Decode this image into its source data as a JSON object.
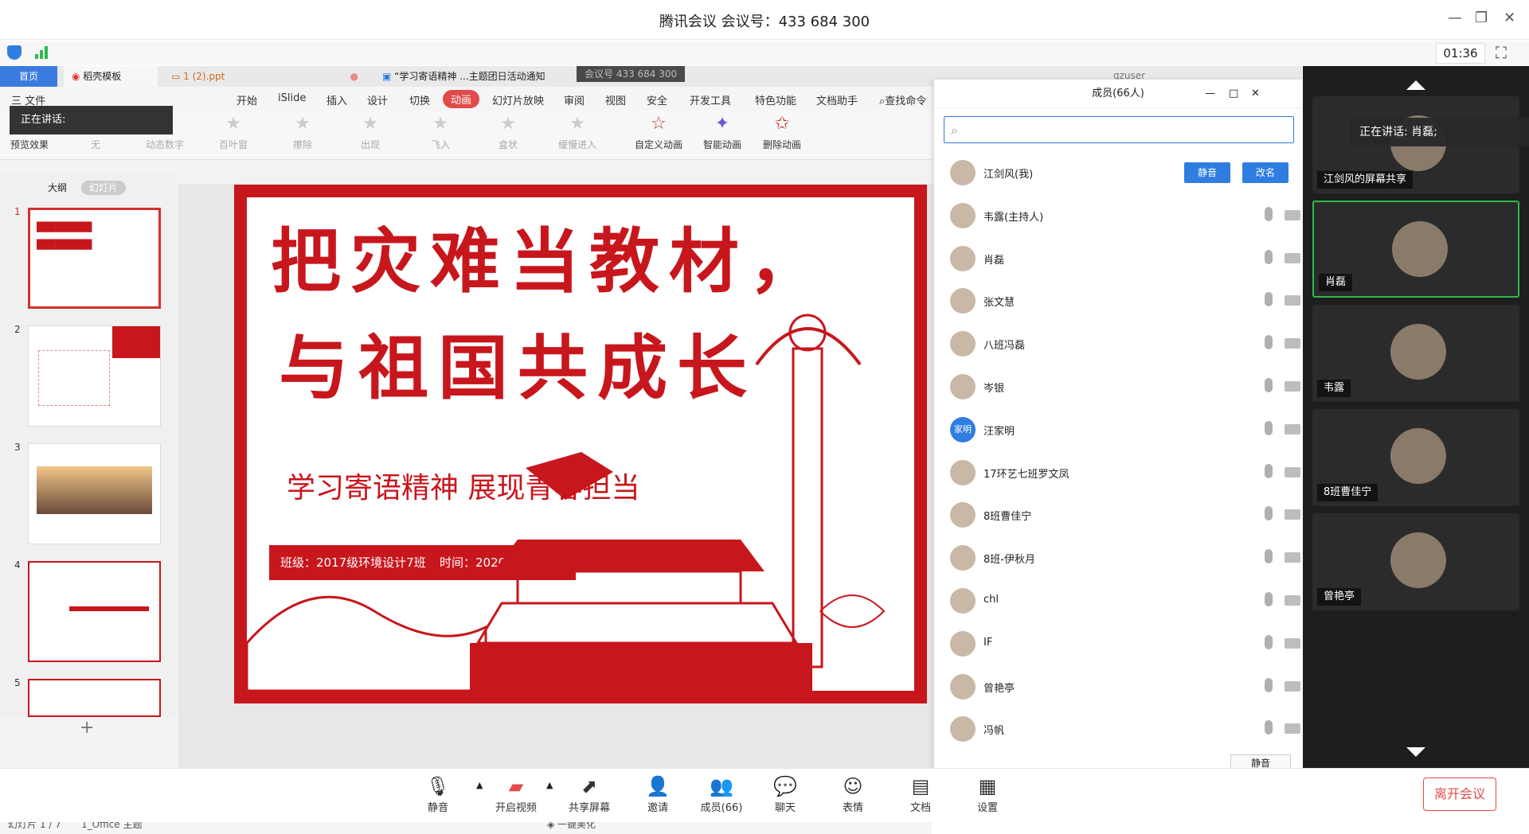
{
  "window": {
    "title": "腾讯会议 会议号：433 684 300",
    "timer": "01:36"
  },
  "wps": {
    "tabs": [
      "首页",
      "稻壳模板",
      "1 (2).ppt",
      "“学习寄语精神 ...主题团日活动通知"
    ],
    "meeting_badge": "会议号 433 684 300",
    "user": "qzuser",
    "menus": [
      "三 文件",
      "开始",
      "iSlide",
      "插入",
      "设计",
      "切换",
      "动画",
      "幻灯片放映",
      "审阅",
      "视图",
      "安全",
      "开发工具",
      "特色功能",
      "文档助手",
      "查找命令"
    ],
    "ribbon": [
      "预览效果",
      "无",
      "动态数字",
      "百叶窗",
      "擦除",
      "出现",
      "飞入",
      "盒状",
      "缓慢进入",
      "自定义动画",
      "智能动画",
      "删除动画"
    ],
    "speaking": "正在讲话:",
    "panel_tabs": [
      "大纲",
      "幻灯片"
    ],
    "slide_nums": [
      "1",
      "2",
      "3",
      "4",
      "5"
    ],
    "slide": {
      "line1": "把灾难当教材，",
      "line2": "与祖国共成长",
      "subtitle": "学习寄语精神 展现青春担当",
      "class_tag": "班级：2017级环境设计7班",
      "time_tag": "时间：2020年5月13日"
    },
    "status": {
      "page": "幻灯片 1 / 7",
      "theme": "1_Office 主题",
      "beautify": "一键美化"
    }
  },
  "members": {
    "title": "成员(66人)",
    "mute_btn": "静音",
    "rename_btn": "改名",
    "mute_all": "静音",
    "list": [
      {
        "name": "江剑风(我)"
      },
      {
        "name": "韦露(主持人)"
      },
      {
        "name": "肖磊"
      },
      {
        "name": "张文慧"
      },
      {
        "name": "八班冯磊"
      },
      {
        "name": "岑银"
      },
      {
        "name": "汪家明"
      },
      {
        "name": "17环艺七班罗文凤"
      },
      {
        "name": "8班曹佳宁"
      },
      {
        "name": "8班-伊秋月"
      },
      {
        "name": "chl"
      },
      {
        "name": "IF"
      },
      {
        "name": "曾艳亭"
      },
      {
        "name": "冯帆"
      }
    ],
    "avatar_text_jm": "家明"
  },
  "video": {
    "speaking": "正在讲话: 肖磊;",
    "tiles": [
      {
        "label": "江剑风的屏幕共享"
      },
      {
        "label": "肖磊"
      },
      {
        "label": "韦露"
      },
      {
        "label": "8班曹佳宁"
      },
      {
        "label": "曾艳亭"
      }
    ]
  },
  "toolbar": {
    "items": [
      "静音",
      "开启视频",
      "共享屏幕",
      "邀请",
      "成员(66)",
      "聊天",
      "表情",
      "文档",
      "设置"
    ],
    "leave": "离开会议"
  }
}
